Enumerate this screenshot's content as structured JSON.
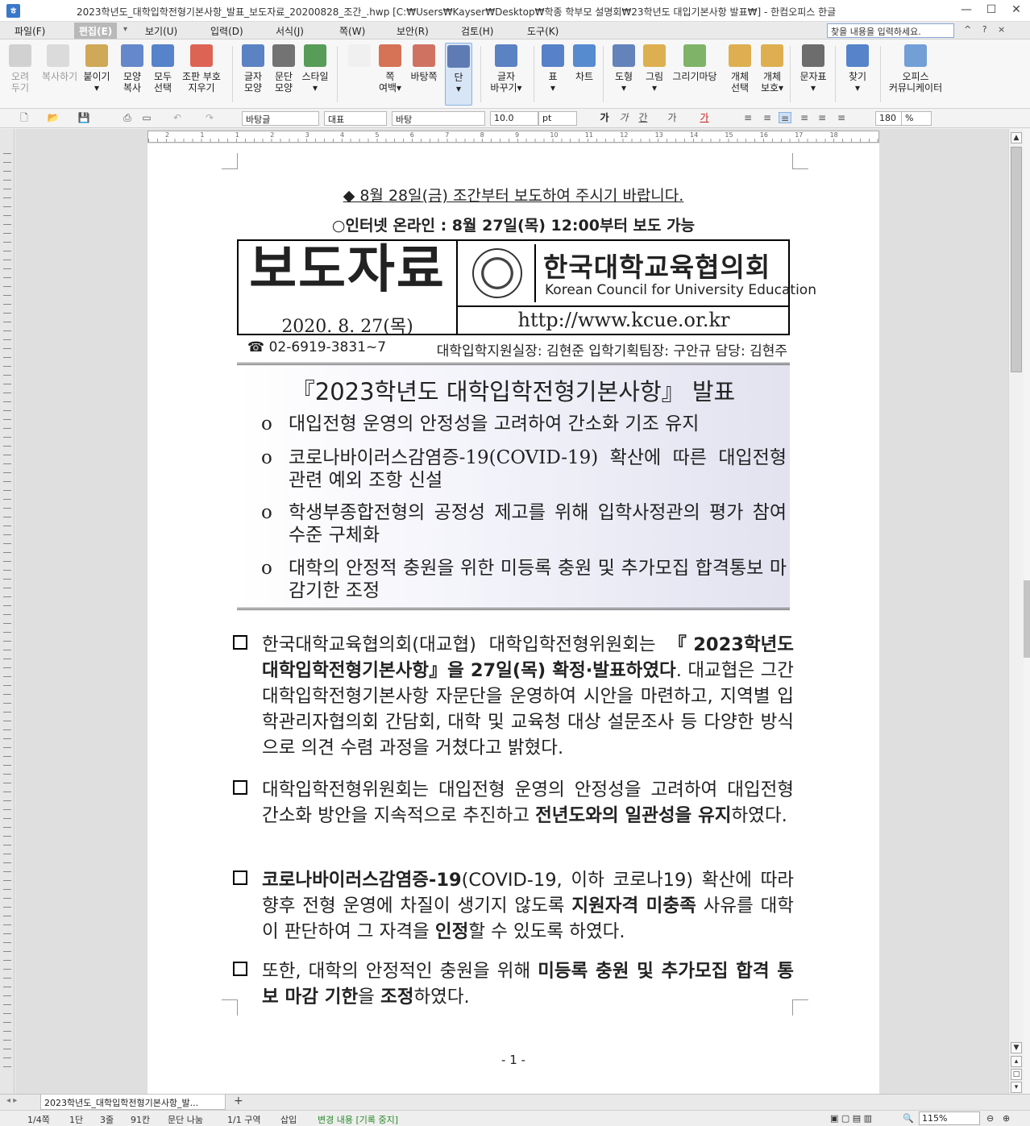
{
  "titlebar": {
    "title": "2023학년도_대학입학전형기본사항_발표_보도자료_20200828_조간_.hwp [C:₩Users₩Kayser₩Desktop₩학종 학부모 설명회₩23학년도 대입기본사항 발표₩] - 한컴오피스 한글",
    "minimize": "—",
    "maximize": "☐",
    "close": "✕"
  },
  "menu": {
    "items": [
      "파일(F)",
      "편집(E)",
      "보기(U)",
      "입력(D)",
      "서식(J)",
      "쪽(W)",
      "보안(R)",
      "검토(H)",
      "도구(K)"
    ],
    "active_index": 1,
    "search_placeholder": "찾을 내용을 입력하세요.",
    "help_icons": "^ ? ×"
  },
  "ribbon": {
    "buttons": [
      {
        "l1": "오려",
        "l2": "두기",
        "icon": "scissors-icon",
        "color": "#b8b8b8",
        "disabled": true
      },
      {
        "l1": "복사하기",
        "l2": "",
        "icon": "copy-icon",
        "color": "#c8c8c8",
        "disabled": true
      },
      {
        "l1": "붙이기",
        "l2": "▾",
        "icon": "paste-icon",
        "color": "#c89a3c",
        "disabled": false
      },
      {
        "l1": "모양",
        "l2": "복사",
        "icon": "format-painter-icon",
        "color": "#4b73c4",
        "disabled": false
      },
      {
        "l1": "모두",
        "l2": "선택",
        "icon": "select-all-icon",
        "color": "#3a6fc2",
        "disabled": false
      },
      {
        "l1": "조판 부호",
        "l2": "지우기",
        "icon": "clear-codes-icon",
        "color": "#d84a38",
        "disabled": false
      },
      {
        "l1": "글자",
        "l2": "모양",
        "icon": "char-shape-icon",
        "color": "#3f6db8",
        "disabled": false
      },
      {
        "l1": "문단",
        "l2": "모양",
        "icon": "para-shape-icon",
        "color": "#5c5c5c",
        "disabled": false
      },
      {
        "l1": "스타일",
        "l2": "▾",
        "icon": "style-icon",
        "color": "#3b8c3b",
        "disabled": false
      },
      {
        "l1": "",
        "l2": "",
        "icon": "page-icon",
        "color": "#eeeeee",
        "disabled": false
      },
      {
        "l1": "쪽",
        "l2": "여백▾",
        "icon": "page-margin-icon",
        "color": "#d05a3a",
        "disabled": false
      },
      {
        "l1": "바탕쪽",
        "l2": "",
        "icon": "master-page-icon",
        "color": "#c85a48",
        "disabled": false
      },
      {
        "l1": "단",
        "l2": "▾",
        "icon": "columns-icon",
        "color": "#4a68a8",
        "disabled": false
      },
      {
        "l1": "글자",
        "l2": "바꾸기▾",
        "icon": "change-case-icon",
        "color": "#3f6db8",
        "disabled": false
      },
      {
        "l1": "표",
        "l2": "▾",
        "icon": "table-icon",
        "color": "#3b6cc0",
        "disabled": false
      },
      {
        "l1": "차트",
        "l2": "",
        "icon": "chart-icon",
        "color": "#3a78c9",
        "disabled": false
      },
      {
        "l1": "도형",
        "l2": "▾",
        "icon": "shape-icon",
        "color": "#4a6fb0",
        "disabled": false
      },
      {
        "l1": "그림",
        "l2": "▾",
        "icon": "picture-icon",
        "color": "#d9a233",
        "disabled": false
      },
      {
        "l1": "그리기마당",
        "l2": "",
        "icon": "clipart-icon",
        "color": "#6aa84f",
        "disabled": false
      },
      {
        "l1": "개체",
        "l2": "선택",
        "icon": "object-select-icon",
        "color": "#d9a233",
        "disabled": false
      },
      {
        "l1": "개체",
        "l2": "보호▾",
        "icon": "object-protect-icon",
        "color": "#d9a233",
        "disabled": false
      },
      {
        "l1": "문자표",
        "l2": "▾",
        "icon": "symbol-icon",
        "color": "#555555",
        "disabled": false
      },
      {
        "l1": "찾기",
        "l2": "▾",
        "icon": "find-icon",
        "color": "#3a6fc2",
        "disabled": false
      },
      {
        "l1": "오피스",
        "l2": "커뮤니케이터",
        "icon": "communicator-icon",
        "color": "#5a8fd0",
        "disabled": false
      }
    ],
    "selected_index": 12
  },
  "format_bar": {
    "style": "바탕글",
    "lang": "대표",
    "font": "바탕",
    "size": "10.0",
    "unit": "pt",
    "zoom": "180",
    "zoom_unit": "%"
  },
  "ruler_numbers": [
    "2",
    "1",
    "1",
    "2",
    "3",
    "4",
    "5",
    "6",
    "7",
    "8",
    "9",
    "10",
    "11",
    "12",
    "13",
    "14",
    "15",
    "16",
    "17",
    "18"
  ],
  "document": {
    "embargo": "◆ 8월 28일(금) 조간부터 보도하여 주시기 바랍니다.",
    "online": "○인터넷 온라인 : 8월 27일(목) 12:00부터 보도 가능",
    "header": {
      "press_release": "보도자료",
      "date": "2020. 8. 27(목)",
      "org_korean": "한국대학교육협의회",
      "org_english": "Korean Council for University Education",
      "url": "http://www.kcue.or.kr"
    },
    "phone": "☎ 02-6919-3831~7",
    "staff": "대학입학지원실장: 김현준  입학기획팀장: 구안규  담당: 김현주",
    "summary_title": "『2023학년도 대학입학전형기본사항』 발표",
    "bullets": [
      "대입전형 운영의 안정성을 고려하여 간소화 기조 유지",
      "코로나바이러스감염증-19(COVID-19) 확산에 따른 대입전형 관련 예외 조항 신설",
      "학생부종합전형의 공정성 제고를 위해 입학사정관의 평가 참여 수준 구체화",
      "대학의 안정적 충원을 위한 미등록 충원 및 추가모집 합격통보 마감기한 조정"
    ],
    "bullet_mark": "o",
    "paragraphs": [
      {
        "a": "한국대학교육협의회(대교협) 대학입학전형위원회는 ",
        "b": "『2023학년도 대학입학전형기본사항』을 27일(목) 확정·발표하였다",
        "c": ". 대교협은 그간 대학입학전형기본사항 자문단을 운영하여 시안을 마련하고, 지역별 입학관리자협의회 간담회, 대학 및 교육청 대상 설문조사 등 다양한 방식으로 의견 수렴 과정을 거쳤다고 밝혔다."
      },
      {
        "a": "대학입학전형위원회는 대입전형 운영의 안정성을 고려하여 대입전형 간소화 방안을 지속적으로 추진하고 ",
        "b": "전년도와의 일관성을 유지",
        "c": "하였다."
      },
      {
        "a": "",
        "b": "코로나바이러스감염증-19",
        "c": "(COVID-19, 이하 코로나19) 확산에 따라 향후 전형 운영에 차질이 생기지 않도록 ",
        "d": "지원자격 미충족",
        "e": " 사유를 대학이 판단하여 그 자격을 ",
        "f": "인정",
        "g": "할 수 있도록 하였다."
      },
      {
        "a": "또한, 대학의 안정적인 충원을 위해 ",
        "b": "미등록 충원 및 추가모집 합격 통보 마감 기한",
        "c": "을 ",
        "d": "조정",
        "e": "하였다."
      }
    ],
    "page_number": "- 1 -"
  },
  "tabbar": {
    "doc_tab": "2023학년도_대학입학전형기본사항_발...",
    "add": "+"
  },
  "status": {
    "page": "1/4쪽",
    "column": "1단",
    "line": "3줄",
    "cell": "91칸",
    "para": "문단 나눔",
    "section": "1/1 구역",
    "insert": "삽입",
    "track": "변경 내용 [기록 중지]",
    "zoom": "115%"
  },
  "colors": {
    "accent": "#3a78c9",
    "summary_bg": "#e2e2f0"
  }
}
